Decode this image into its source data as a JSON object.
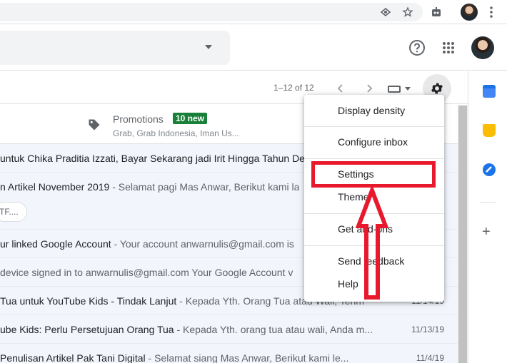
{
  "browser": {
    "icons": [
      "eye-icon",
      "star-icon",
      "extension-icon",
      "avatar",
      "more-vert-icon"
    ]
  },
  "header": {
    "icons": [
      "help-icon",
      "apps-icon",
      "avatar"
    ]
  },
  "toolbar": {
    "pager_text": "1–12 of 12"
  },
  "category": {
    "title": "Promotions",
    "badge": "10 new",
    "senders": "Grab, Grab Indonesia, Iman Us..."
  },
  "emails": [
    {
      "subject": "untuk Chika Praditia Izzati, Bayar Sekarang jadi Irit Hingga Tahun De",
      "snippet": "",
      "date": ""
    },
    {
      "subject": "n Artikel November 2019",
      "snippet": " - Selamat pagi Mas Anwar, Berikut kami la",
      "date": ""
    },
    {
      "subject": "ur linked Google Account",
      "snippet": " - Your account anwarnulis@gmail.com is",
      "date": ""
    },
    {
      "subject": "",
      "snippet": " device signed in to anwarnulis@gmail.com Your Google Account v",
      "date": ""
    },
    {
      "subject": "Tua untuk YouTube Kids - Tindak Lanjut",
      "snippet": " - Kepada Yth. Orang Tua atau Wali, Terim",
      "date": "11/14/19"
    },
    {
      "subject": "ube Kids: Perlu Persetujuan Orang Tua",
      "snippet": " - Kepada Yth. orang tua atau wali, Anda m...",
      "date": "11/13/19"
    },
    {
      "subject": "Penulisan Artikel Pak Tani Digital",
      "snippet": " - Selamat siang Mas Anwar, Berikut kami le...",
      "date": "11/4/19"
    }
  ],
  "attachment_chip": "TF....",
  "settings_menu": {
    "items": [
      "Display density",
      "Configure inbox",
      "Settings",
      "Theme",
      "Get add-ons",
      "Send feedback",
      "Help"
    ]
  },
  "colors": {
    "highlight": "#e8192c",
    "badge": "#188038"
  }
}
